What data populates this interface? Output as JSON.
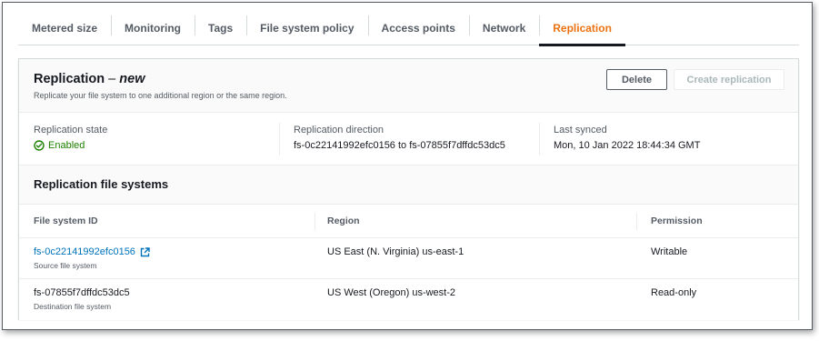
{
  "tabs": [
    {
      "label": "Metered size"
    },
    {
      "label": "Monitoring"
    },
    {
      "label": "Tags"
    },
    {
      "label": "File system policy"
    },
    {
      "label": "Access points"
    },
    {
      "label": "Network"
    },
    {
      "label": "Replication",
      "active": true
    }
  ],
  "panel": {
    "title": "Replication",
    "title_dash": " – ",
    "title_tag": "new",
    "subtitle": "Replicate your file system to one additional region or the same region.",
    "delete_label": "Delete",
    "create_label": "Create replication"
  },
  "summary": {
    "state_label": "Replication state",
    "state_value": "Enabled",
    "state_icon": "check-circle-icon",
    "direction_label": "Replication direction",
    "direction_value": "fs-0c22141992efc0156 to fs-07855f7dffdc53dc5",
    "synced_label": "Last synced",
    "synced_value": "Mon, 10 Jan 2022 18:44:34 GMT"
  },
  "systems": {
    "title": "Replication file systems",
    "columns": [
      "File system ID",
      "Region",
      "Permission"
    ],
    "rows": [
      {
        "id": "fs-0c22141992efc0156",
        "id_sub": "Source file system",
        "region": "US East (N. Virginia) us-east-1",
        "permission": "Writable",
        "link": true,
        "icon": "external-link-icon"
      },
      {
        "id": "fs-07855f7dffdc53dc5",
        "id_sub": "Destination file system",
        "region": "US West (Oregon) us-west-2",
        "permission": "Read-only",
        "link": false
      }
    ]
  },
  "colors": {
    "accent": "#ec7211",
    "link": "#0073bb",
    "success": "#1d8102",
    "text": "#16191f",
    "muted": "#545b64"
  }
}
